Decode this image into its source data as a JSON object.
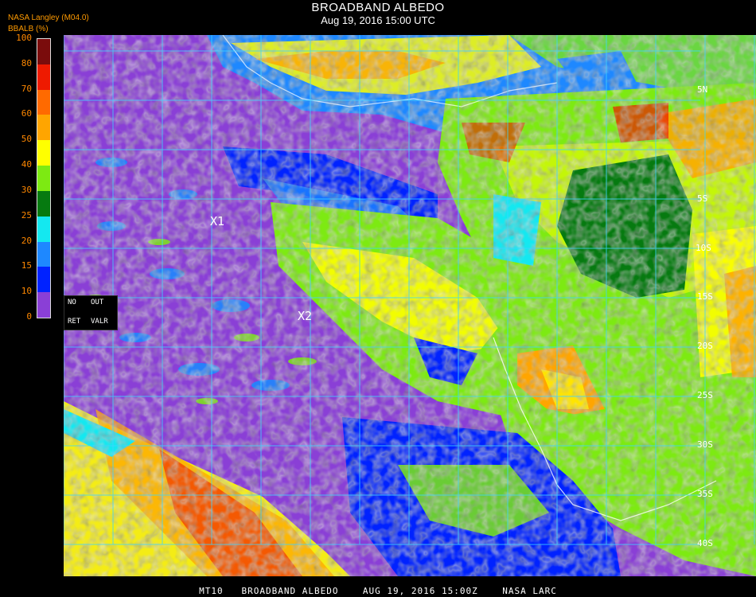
{
  "header": {
    "title": "BROADBAND ALBEDO",
    "subtitle": "Aug 19, 2016 15:00 UTC"
  },
  "source_label": "NASA Langley (M04.0)",
  "colorbar": {
    "title": "BBALB (%)",
    "ticks": [
      "100",
      "80",
      "70",
      "60",
      "50",
      "40",
      "30",
      "25",
      "20",
      "15",
      "10",
      "0"
    ],
    "bands": [
      {
        "from": 0,
        "to": 10,
        "color": "#8a3fd6"
      },
      {
        "from": 10,
        "to": 15,
        "color": "#0022ff"
      },
      {
        "from": 15,
        "to": 20,
        "color": "#1e88ff"
      },
      {
        "from": 20,
        "to": 25,
        "color": "#14e8f0"
      },
      {
        "from": 25,
        "to": 30,
        "color": "#067a10"
      },
      {
        "from": 30,
        "to": 40,
        "color": "#7dea12"
      },
      {
        "from": 40,
        "to": 50,
        "color": "#ffff00"
      },
      {
        "from": 50,
        "to": 60,
        "color": "#ffa500"
      },
      {
        "from": 60,
        "to": 70,
        "color": "#ff6a00"
      },
      {
        "from": 70,
        "to": 80,
        "color": "#ee1a00"
      },
      {
        "from": 80,
        "to": 100,
        "color": "#7a0c0c"
      }
    ]
  },
  "legend_box": {
    "no": "NO",
    "out": "OUT",
    "ret": "RET",
    "valr": "VALR"
  },
  "markers": [
    {
      "label": "X1"
    },
    {
      "label": "X2"
    }
  ],
  "lat_labels": [
    "5N",
    "5S",
    "10S",
    "15S",
    "20S",
    "25S",
    "30S",
    "35S",
    "40S"
  ],
  "footer": "MT10   BROADBAND ALBEDO    AUG 19, 2016 15:00Z    NASA LARC"
}
